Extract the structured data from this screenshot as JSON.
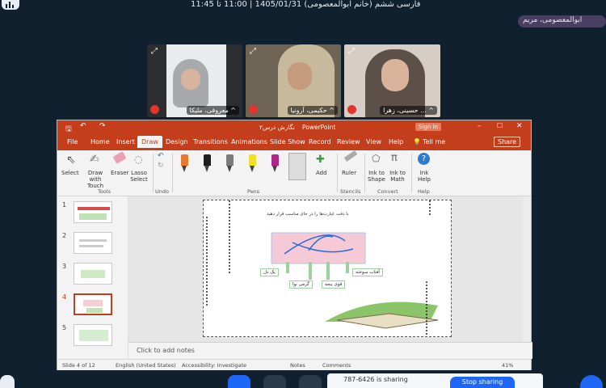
{
  "meeting": {
    "title": "فارسی ششم (خانم ابوالمعصومی) 1405/01/31 | 11:00 تا 11:45",
    "user_badge": "ابوالمعصومی، مریم"
  },
  "participants": [
    {
      "name": "معروفی، ملیکا ^"
    },
    {
      "name": "حکیمی، آرونیا ^"
    },
    {
      "name": "حسینی، زهرا ... ^"
    }
  ],
  "ppt": {
    "file_title": "نگارش درس۲",
    "app_name": "PowerPoint",
    "sign_in": "Sign in",
    "tabs": [
      "File",
      "Home",
      "Insert",
      "Draw",
      "Design",
      "Transitions",
      "Animations",
      "Slide Show",
      "Record",
      "Review",
      "View",
      "Help"
    ],
    "active_tab": "Draw",
    "tell_me": "Tell me",
    "share": "Share",
    "tools": {
      "select": "Select",
      "draw_touch": "Draw with Touch",
      "eraser": "Eraser",
      "lasso": "Lasso Select",
      "add": "Add",
      "ruler": "Ruler",
      "ink_shape": "Ink to Shape",
      "ink_math": "Ink to Math",
      "ink_help": "Ink Help"
    },
    "groups": {
      "tools": "Tools",
      "undo": "Undo",
      "pens": "Pens",
      "stencils": "Stencils",
      "convert": "Convert",
      "help": "Help"
    },
    "pen_colors": [
      "#e8792c",
      "#1e1e1e",
      "#7a7a7a",
      "#f1e02a",
      "#b0248c",
      "#2d9be0"
    ],
    "thumbnails": [
      "1",
      "2",
      "3",
      "4",
      "5"
    ],
    "selected_thumbnail": "4",
    "notes_placeholder": "Click to add notes",
    "slide": {
      "instruction": "با دقت عبارت‌ها را در جای مناسب قرار دهید",
      "words_top": "آفتاب سوخته",
      "boxes": [
        "یک دل",
        "آفتاب سوخته",
        "گرمی نوا",
        "قوی پنجه"
      ]
    },
    "status": {
      "slide_of": "Slide 4 of 12",
      "language": "English (United States)",
      "accessibility": "Accessibility: Investigate",
      "notes": "Notes",
      "comments": "Comments",
      "zoom": "41%"
    }
  },
  "controls": {
    "share_stop": "Stop sharing",
    "share_label": "787-6426 is sharing"
  }
}
